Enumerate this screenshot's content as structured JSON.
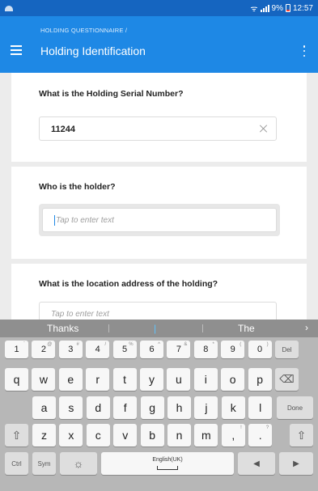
{
  "status_bar": {
    "battery": "9%",
    "time": "12:57"
  },
  "app_bar": {
    "breadcrumb": "HOLDING QUESTIONNAIRE /",
    "title": "Holding Identification",
    "menu_icon": "hamburger-menu-icon",
    "overflow_icon": "more-vertical-icon"
  },
  "questions": [
    {
      "label": "What is the Holding Serial Number?",
      "value": "11244",
      "placeholder": ""
    },
    {
      "label": "Who is the holder?",
      "value": "",
      "placeholder": "Tap to enter text"
    },
    {
      "label": "What is the location address of the holding?",
      "value": "",
      "placeholder": "Tap to enter text"
    }
  ],
  "colors": {
    "status_bar": "#1565c0",
    "app_bar": "#1e88e5",
    "cursor": "#1e88e5"
  },
  "keyboard": {
    "suggestions": [
      "Thanks",
      "|",
      "The"
    ],
    "suggest_more": "›",
    "number_row": [
      {
        "k": "1",
        "s": "`"
      },
      {
        "k": "2",
        "s": "@"
      },
      {
        "k": "3",
        "s": "#"
      },
      {
        "k": "4",
        "s": "/"
      },
      {
        "k": "5",
        "s": "%"
      },
      {
        "k": "6",
        "s": "^"
      },
      {
        "k": "7",
        "s": "&"
      },
      {
        "k": "8",
        "s": "*"
      },
      {
        "k": "9",
        "s": "("
      },
      {
        "k": "0",
        "s": ")"
      }
    ],
    "del_label": "Del",
    "row1": [
      "q",
      "w",
      "e",
      "r",
      "t",
      "y",
      "u",
      "i",
      "o",
      "p"
    ],
    "backspace_icon": "⌫",
    "row2": [
      "a",
      "s",
      "d",
      "f",
      "g",
      "h",
      "j",
      "k",
      "l"
    ],
    "done_label": "Done",
    "shift_icon": "⇧",
    "row3": [
      "z",
      "x",
      "c",
      "v",
      "b",
      "n",
      "m",
      ",",
      "."
    ],
    "row3_sup": [
      "",
      "",
      "",
      "",
      "",
      "",
      "",
      "!",
      "?"
    ],
    "ctrl_label": "Ctrl",
    "sym_label": "Sym",
    "settings_icon": "☼",
    "space_label": "English(UK)",
    "left_arrow": "◀",
    "right_arrow": "▶"
  }
}
